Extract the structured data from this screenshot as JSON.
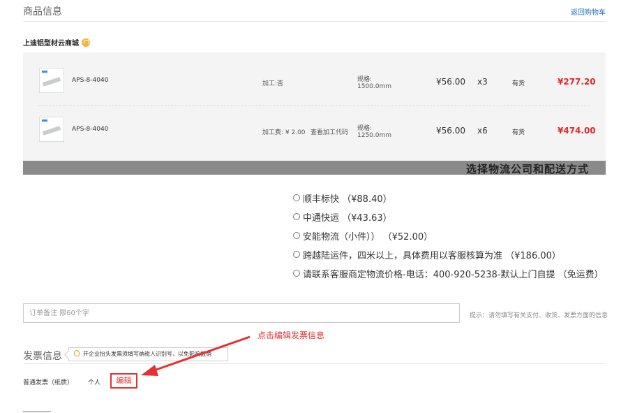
{
  "header": {
    "title": "商品信息",
    "back_link": "返回购物车"
  },
  "store": {
    "name": "上迪铝型材云商城"
  },
  "items": [
    {
      "name": "APS-8-4040",
      "processing": "加工:否",
      "view_code": "",
      "spec_label": "规格:",
      "spec_value": "1500.0mm",
      "price": "¥56.00",
      "qty": "x3",
      "stock": "有货",
      "total": "¥277.20"
    },
    {
      "name": "APS-8-4040",
      "processing": "加工费: ¥ 2.00",
      "view_code": "查看加工代码",
      "spec_label": "规格:",
      "spec_value": "1250.0mm",
      "price": "¥56.00",
      "qty": "x6",
      "stock": "有货",
      "total": "¥474.00"
    }
  ],
  "shipping": {
    "title": "选择物流公司和配送方式",
    "options": [
      "顺丰标快  （¥88.40）",
      "中通快运  （¥43.63）",
      "安能物流（小件））  （¥52.00）",
      "跨越陆运件，四米以上，具体费用以客服核算为准  （¥186.00）",
      "请联系客服商定物流价格-电话：400-920-5238-默认上门自提  （免运费）"
    ]
  },
  "note": {
    "placeholder": "订单备注 限60个字",
    "hint": "提示：请勿填写有关支付、收货、发票方面的信息"
  },
  "invoice": {
    "title": "发票信息",
    "tooltip": "开企业抬头发票须填写纳税人识别号，以免影响报销",
    "type": "普通发票（纸质）",
    "holder": "个人",
    "edit_label": "编辑",
    "annotation": "点击编辑发票信息"
  },
  "colors": {
    "accent_red": "#e53131",
    "price_red": "#e4262d",
    "link_blue": "#1f6fbf",
    "banner_gray": "#8a8a8a"
  },
  "icons": [
    "store-icon",
    "lightbulb-icon",
    "radio-icon",
    "arrow-icon"
  ]
}
